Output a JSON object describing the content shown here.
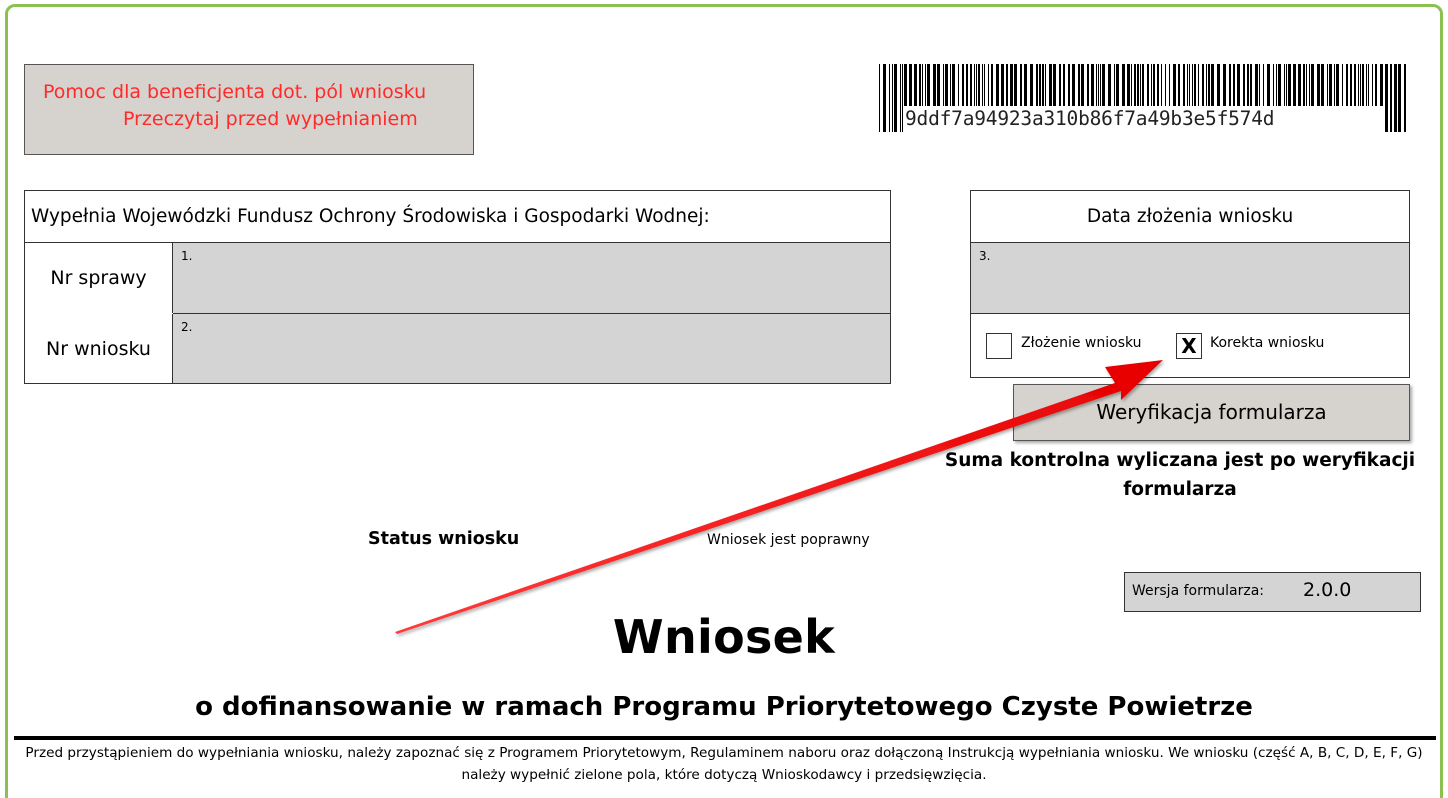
{
  "help": {
    "line1": "Pomoc dla beneficjenta dot. pól wniosku",
    "line2": "Przeczytaj przed wypełnianiem"
  },
  "barcode": {
    "text": "9ddf7a94923a310b86f7a49b3e5f574d"
  },
  "fund_section": {
    "heading": "Wypełnia Wojewódzki Fundusz Ochrony Środowiska i Gospodarki Wodnej:",
    "rows": [
      {
        "label": "Nr sprawy",
        "field_number": "1.",
        "value": ""
      },
      {
        "label": "Nr wniosku",
        "field_number": "2.",
        "value": ""
      }
    ]
  },
  "date_section": {
    "heading": "Data  złożenia wniosku",
    "field_number": "3.",
    "value": "",
    "options": [
      {
        "label": "Złożenie wniosku",
        "checked": false,
        "mark": ""
      },
      {
        "label": "Korekta wniosku",
        "checked": true,
        "mark": "X"
      }
    ]
  },
  "verify_button": "Weryfikacja formularza",
  "checksum_note": "Suma kontrolna wyliczana jest po weryfikacji formularza",
  "status": {
    "label": "Status wniosku",
    "value": "Wniosek jest poprawny"
  },
  "version": {
    "label": "Wersja formularza:",
    "value": "2.0.0"
  },
  "title": "Wniosek",
  "subtitle": "o dofinansowanie w ramach Programu Priorytetowego Czyste Powietrze",
  "intro": "Przed przystąpieniem do wypełniania wniosku, należy zapoznać się z Programem Priorytetowym, Regulaminem naboru oraz dołączoną Instrukcją wypełniania wniosku. We wniosku (część A, B, C, D, E, F, G) należy wypełnić zielone pola, które dotyczą Wnioskodawcy i przedsięwzięcia.",
  "colors": {
    "frame": "#8cc152",
    "help_text": "#ff2a2a",
    "field_fill": "#d4d4d4",
    "button_fill": "#d6d3ce",
    "annotation_arrow": "#ff1a1a"
  },
  "icons": {
    "barcode": "barcode-icon",
    "arrow": "red-annotation-arrow-icon"
  }
}
